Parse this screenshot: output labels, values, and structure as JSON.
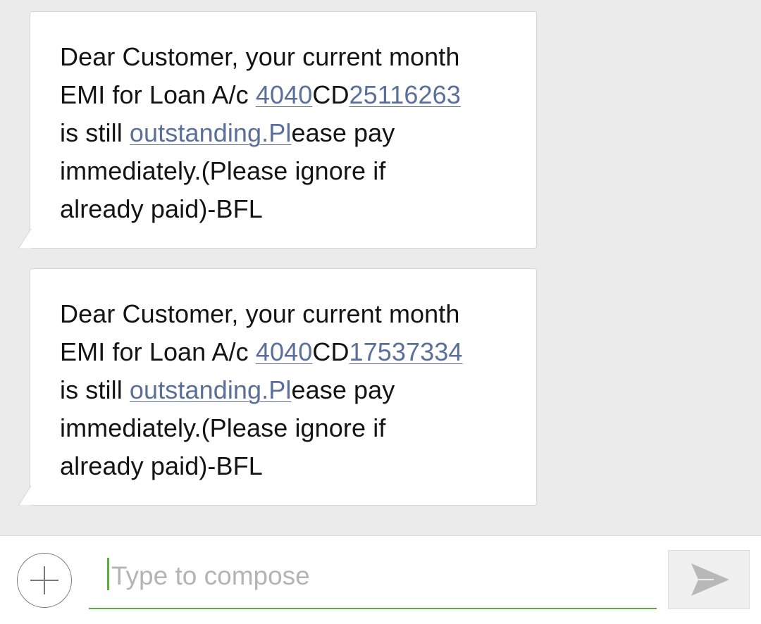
{
  "messages": [
    {
      "line1": "Dear Customer, your current month",
      "line2_prefix": "EMI for Loan A/c ",
      "line2_link1": "4040",
      "line2_mid": "CD",
      "line2_link2": "25116263",
      "line3_prefix": "is still ",
      "line3_link": "outstanding.Pl",
      "line3_suffix": "ease pay",
      "line4": "immediately.(Please ignore if",
      "line5": "already paid)-BFL"
    },
    {
      "line1": "Dear Customer, your current month",
      "line2_prefix": "EMI for Loan A/c ",
      "line2_link1": "4040",
      "line2_mid": "CD",
      "line2_link2": "17537334",
      "line3_prefix": "is still ",
      "line3_link": "outstanding.Pl",
      "line3_suffix": "ease pay",
      "line4": "immediately.(Please ignore if",
      "line5": "already paid)-BFL"
    }
  ],
  "compose": {
    "placeholder": "Type to compose",
    "value": ""
  },
  "icons": {
    "add": "plus-circle-icon",
    "send": "send-arrow-icon"
  },
  "colors": {
    "background": "#ebebeb",
    "bubble": "#ffffff",
    "link": "#5a6f99",
    "accent": "#5fae3c"
  }
}
